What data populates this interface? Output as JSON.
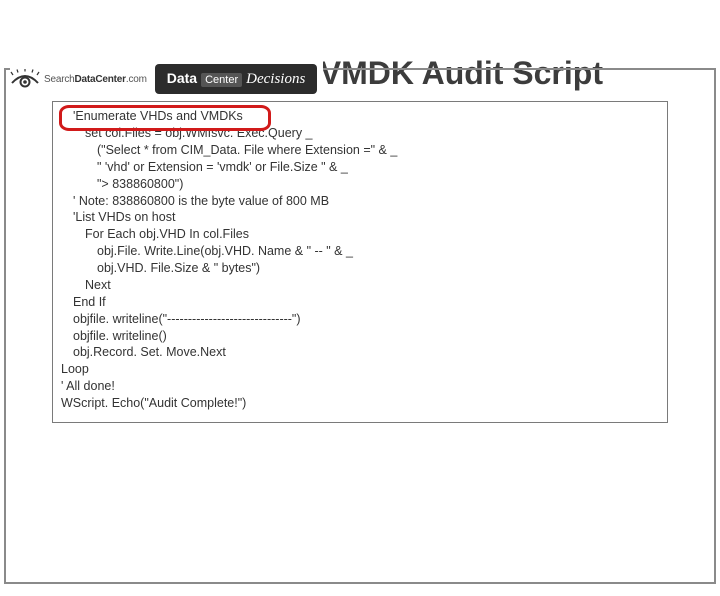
{
  "header": {
    "sdc_thin": "Search",
    "sdc_bold": "DataCenter",
    "sdc_suffix": ".com",
    "badge_b1": "Data",
    "badge_b2": "Center",
    "badge_b3": "Decisions"
  },
  "title": "Domain VHD/VMDK Audit Script",
  "code": {
    "l01": "'Enumerate VHDs and VMDKs",
    "l02": "set col.Files = obj.WMIsvc. Exec.Query _",
    "l03": "(\"Select * from CIM_Data. File where Extension =\" & _",
    "l04": "\" 'vhd' or Extension = 'vmdk' or File.Size \" & _",
    "l05": "\"> 838860800\")",
    "l06": "' Note: 838860800 is the byte value of 800 MB",
    "l07": "'List VHDs on host",
    "l08": "For Each obj.VHD In col.Files",
    "l09": "obj.File. Write.Line(obj.VHD. Name & \" -- \" & _",
    "l10": "obj.VHD. File.Size & \" bytes\")",
    "l11": "Next",
    "l12": "End If",
    "l13": "objfile. writeline(\"------------------------------\")",
    "l14": "objfile. writeline()",
    "l15": "obj.Record. Set. Move.Next",
    "l16": "Loop",
    "l17": "' All done!",
    "l18": "WScript. Echo(\"Audit Complete!\")"
  }
}
